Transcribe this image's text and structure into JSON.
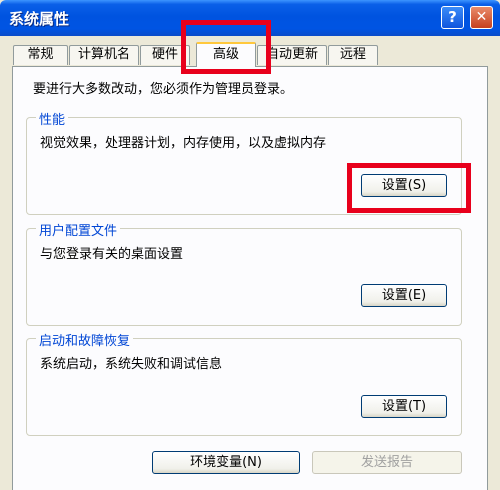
{
  "window": {
    "title": "系统属性",
    "help_glyph": "?",
    "close_glyph": "✕"
  },
  "tabs": [
    {
      "label": "常规",
      "active": false
    },
    {
      "label": "计算机名",
      "active": false
    },
    {
      "label": "硬件",
      "active": false
    },
    {
      "label": "高级",
      "active": true
    },
    {
      "label": "自动更新",
      "active": false
    },
    {
      "label": "远程",
      "active": false
    }
  ],
  "intro": "要进行大多数改动，您必须作为管理员登录。",
  "groups": {
    "performance": {
      "title": "性能",
      "desc": "视觉效果，处理器计划，内存使用，以及虚拟内存",
      "button": "设置(S)"
    },
    "profiles": {
      "title": "用户配置文件",
      "desc": "与您登录有关的桌面设置",
      "button": "设置(E)"
    },
    "startup": {
      "title": "启动和故障恢复",
      "desc": "系统启动，系统失败和调试信息",
      "button": "设置(T)"
    }
  },
  "bottom": {
    "env_button": "环境变量(N)",
    "report_button": "发送报告"
  },
  "highlight_color": "#E8001C"
}
